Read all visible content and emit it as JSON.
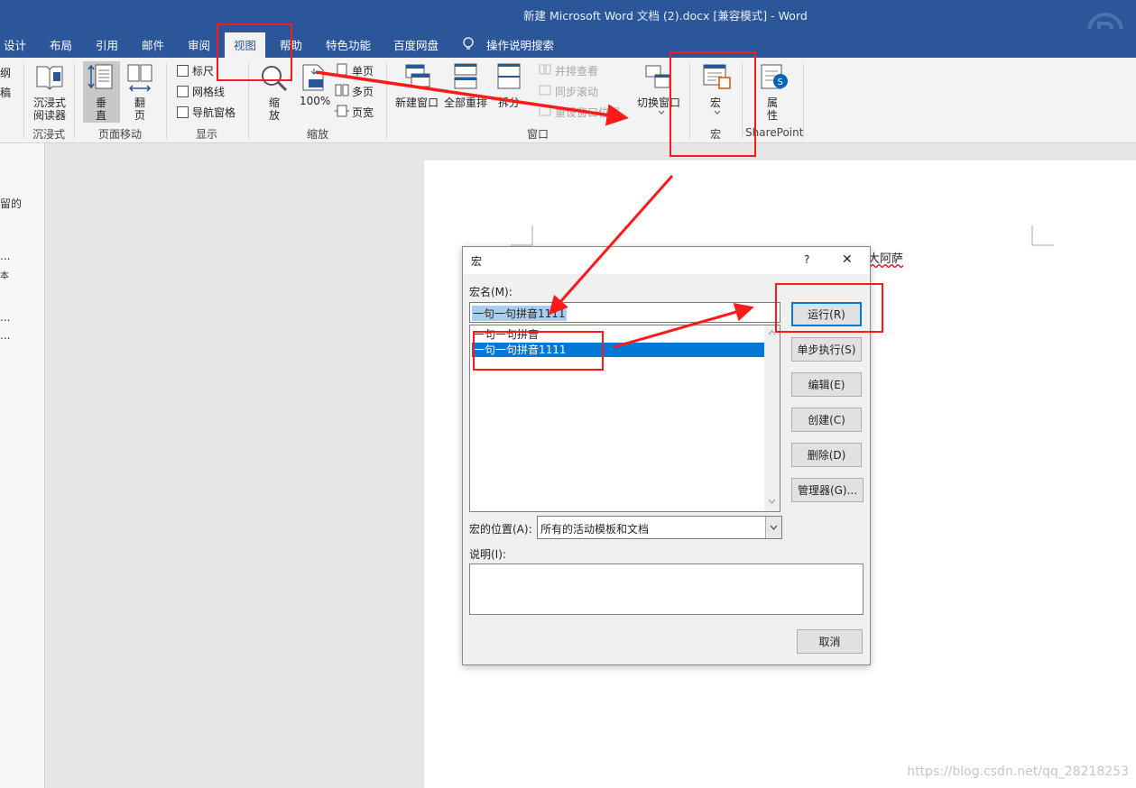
{
  "window": {
    "title": "新建 Microsoft Word 文档 (2).docx [兼容模式]  -  Word"
  },
  "tabs": [
    {
      "label": "设计"
    },
    {
      "label": "布局"
    },
    {
      "label": "引用"
    },
    {
      "label": "邮件"
    },
    {
      "label": "审阅"
    },
    {
      "label": "视图",
      "active": true
    },
    {
      "label": "帮助"
    },
    {
      "label": "特色功能"
    },
    {
      "label": "百度网盘"
    },
    {
      "label": "操作说明搜索"
    }
  ],
  "ribbon": {
    "views": {
      "partial_top": "纲",
      "partial_bottom": "稿"
    },
    "immersive": {
      "reader_label": "沉浸式\n阅读器",
      "reader_line1": "沉浸式",
      "reader_line2": "阅读器",
      "group": "沉浸式"
    },
    "page_move": {
      "vertical_line1": "垂",
      "vertical_line2": "直",
      "flip_line1": "翻",
      "flip_line2": "页",
      "group": "页面移动"
    },
    "show": {
      "ruler": "标尺",
      "gridlines": "网格线",
      "nav_pane": "导航窗格",
      "group": "显示"
    },
    "zoom": {
      "zoom_line1": "缩",
      "zoom_line2": "放",
      "percent": "100%",
      "one_page": "单页",
      "multi_page": "多页",
      "page_width": "页宽",
      "group": "缩放"
    },
    "window": {
      "new_window": "新建窗口",
      "arrange_all": "全部重排",
      "split": "拆分",
      "side_by_side": "并排查看",
      "sync_scroll": "同步滚动",
      "reset_pos": "重设窗口位置",
      "switch_windows": "切换窗口",
      "group": "窗口"
    },
    "macros": {
      "label": "宏",
      "group": "宏"
    },
    "sharepoint": {
      "props_line1": "属",
      "props_line2": "性",
      "group": "SharePoint"
    }
  },
  "nav_fragments": [
    "留的",
    "...",
    "本",
    "...",
    "..."
  ],
  "document": {
    "visible_text": "大阿萨"
  },
  "dialog": {
    "title": "宏",
    "help": "?",
    "close": "✕",
    "macro_name_label": "宏名(M):",
    "macro_name_value": "一句一句拼音1111",
    "macros": [
      {
        "name": "一句一句拼音",
        "selected": false
      },
      {
        "name": "一句一句拼音1111",
        "selected": true
      }
    ],
    "buttons": {
      "run": "运行(R)",
      "step_into": "单步执行(S)",
      "edit": "编辑(E)",
      "create": "创建(C)",
      "delete": "删除(D)",
      "organizer": "管理器(G)...",
      "cancel": "取消"
    },
    "location_label": "宏的位置(A):",
    "location_value": "所有的活动模板和文档",
    "description_label": "说明(I):"
  },
  "watermark": "https://blog.csdn.net/qq_28218253",
  "colors": {
    "titlebar": "#2b579a",
    "annotation": "#ff1a1a",
    "selection": "#0078d7"
  }
}
